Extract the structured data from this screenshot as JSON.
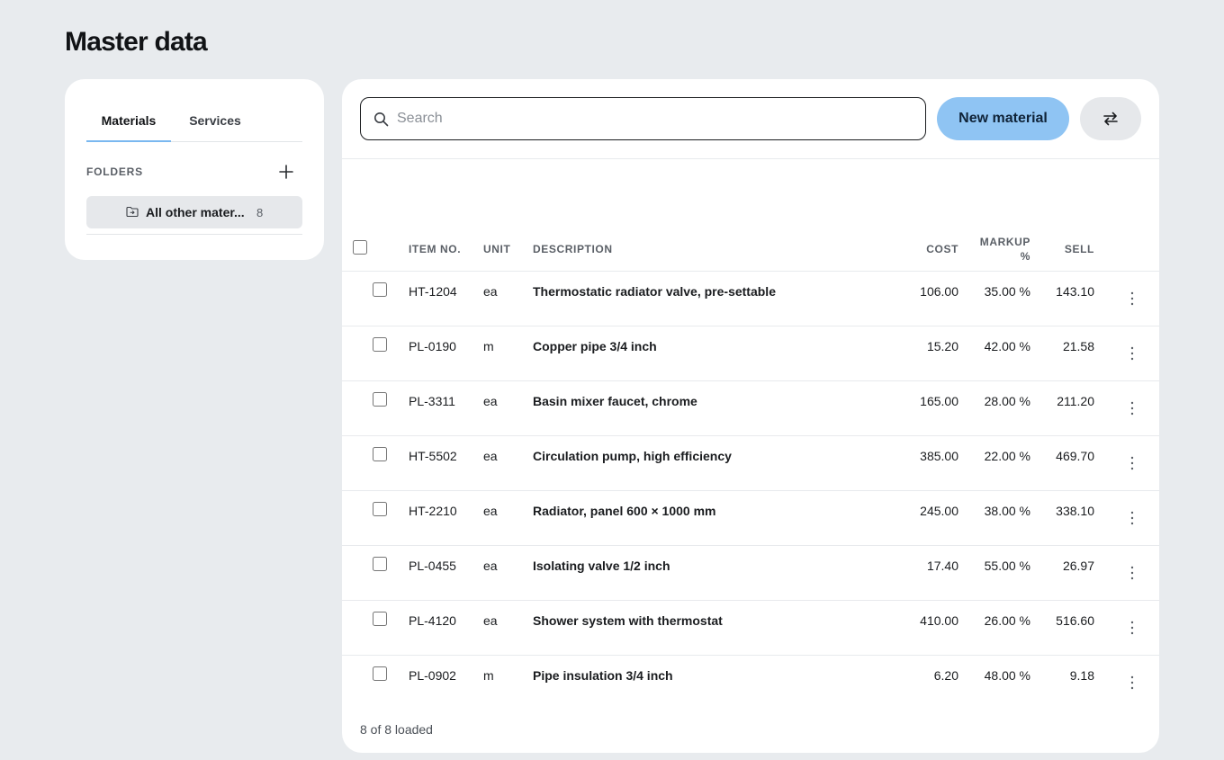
{
  "page": {
    "title": "Master data"
  },
  "sidebar": {
    "tabs": [
      {
        "label": "Materials",
        "active": true
      },
      {
        "label": "Services",
        "active": false
      }
    ],
    "folders_label": "FOLDERS",
    "folder": {
      "label": "All other mater...",
      "count": "8"
    }
  },
  "toolbar": {
    "search_placeholder": "Search",
    "search_value": "",
    "new_label": "New material"
  },
  "table": {
    "columns": {
      "item_no": "ITEM NO.",
      "unit": "UNIT",
      "description": "DESCRIPTION",
      "cost": "COST",
      "markup_line1": "MARKUP",
      "markup_line2": "%",
      "sell": "SELL"
    },
    "rows": [
      {
        "item_no": "HT-1204",
        "unit": "ea",
        "description": "Thermostatic radiator valve, pre-settable",
        "cost": "106.00",
        "markup": "35.00 %",
        "sell": "143.10"
      },
      {
        "item_no": "PL-0190",
        "unit": "m",
        "description": "Copper pipe 3/4 inch",
        "cost": "15.20",
        "markup": "42.00 %",
        "sell": "21.58"
      },
      {
        "item_no": "PL-3311",
        "unit": "ea",
        "description": "Basin mixer faucet, chrome",
        "cost": "165.00",
        "markup": "28.00 %",
        "sell": "211.20"
      },
      {
        "item_no": "HT-5502",
        "unit": "ea",
        "description": "Circulation pump, high efficiency",
        "cost": "385.00",
        "markup": "22.00 %",
        "sell": "469.70"
      },
      {
        "item_no": "HT-2210",
        "unit": "ea",
        "description": "Radiator, panel 600 × 1000 mm",
        "cost": "245.00",
        "markup": "38.00 %",
        "sell": "338.10"
      },
      {
        "item_no": "PL-0455",
        "unit": "ea",
        "description": "Isolating valve 1/2 inch",
        "cost": "17.40",
        "markup": "55.00 %",
        "sell": "26.97"
      },
      {
        "item_no": "PL-4120",
        "unit": "ea",
        "description": "Shower system with thermostat",
        "cost": "410.00",
        "markup": "26.00 %",
        "sell": "516.60"
      },
      {
        "item_no": "PL-0902",
        "unit": "m",
        "description": "Pipe insulation 3/4 inch",
        "cost": "6.20",
        "markup": "48.00 %",
        "sell": "9.18"
      }
    ]
  },
  "footer": {
    "loaded_text": "8 of 8 loaded"
  },
  "icons": {
    "search": "search-icon",
    "add": "plus-icon",
    "folder": "folder-icon",
    "swap": "swap-arrows-icon",
    "row_menu": "more-vertical-icon"
  },
  "colors": {
    "accent": "#8fc4f3",
    "tab_underline": "#7ab8f0",
    "background": "#e8ebee"
  }
}
